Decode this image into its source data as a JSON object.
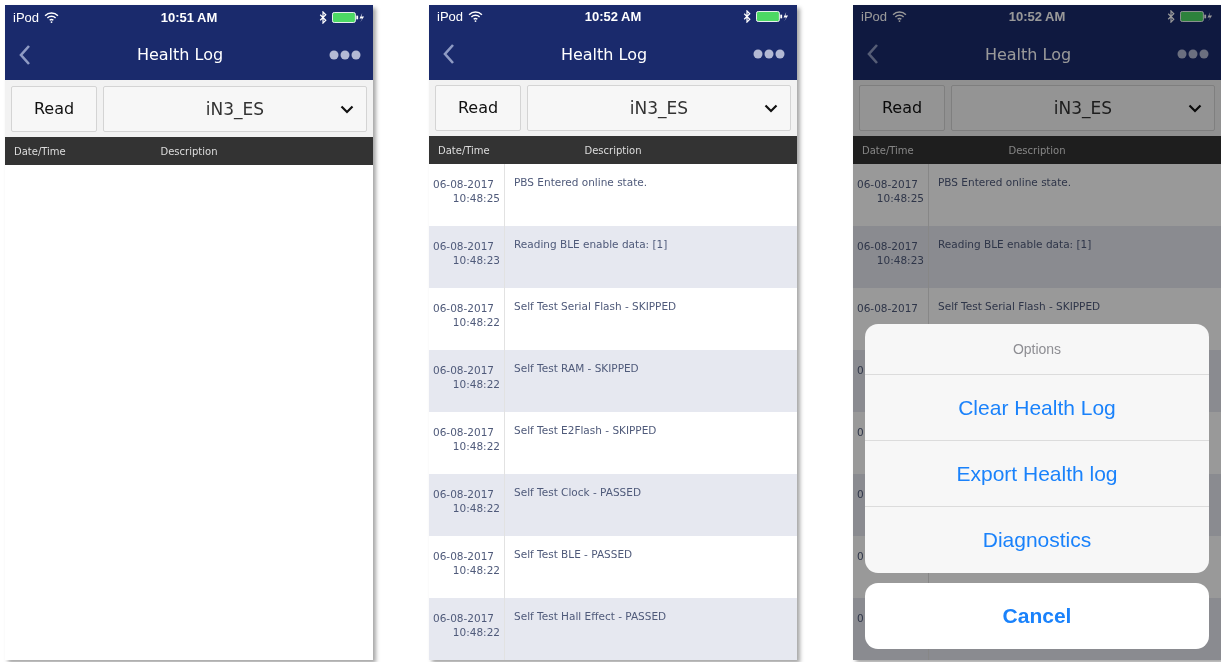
{
  "screens": [
    {
      "status_bar": {
        "carrier": "iPod",
        "time": "10:51 AM"
      },
      "title": "Health Log",
      "read_button": "Read",
      "device": "iN3_ES",
      "columns": [
        "Date/Time",
        "Description"
      ]
    },
    {
      "status_bar": {
        "carrier": "iPod",
        "time": "10:52 AM"
      },
      "title": "Health Log",
      "read_button": "Read",
      "device": "iN3_ES",
      "columns": [
        "Date/Time",
        "Description"
      ],
      "rows": [
        {
          "date": "06-08-2017",
          "time": "10:48:25",
          "description": "PBS Entered online state."
        },
        {
          "date": "06-08-2017",
          "time": "10:48:23",
          "description": "Reading BLE enable data: [1]"
        },
        {
          "date": "06-08-2017",
          "time": "10:48:22",
          "description": "Self Test Serial Flash - SKIPPED"
        },
        {
          "date": "06-08-2017",
          "time": "10:48:22",
          "description": "Self Test RAM - SKIPPED"
        },
        {
          "date": "06-08-2017",
          "time": "10:48:22",
          "description": "Self Test E2Flash - SKIPPED"
        },
        {
          "date": "06-08-2017",
          "time": "10:48:22",
          "description": "Self Test Clock - PASSED"
        },
        {
          "date": "06-08-2017",
          "time": "10:48:22",
          "description": "Self Test BLE - PASSED"
        },
        {
          "date": "06-08-2017",
          "time": "10:48:22",
          "description": "Self Test Hall Effect - PASSED"
        }
      ]
    },
    {
      "status_bar": {
        "carrier": "iPod",
        "time": "10:52 AM"
      },
      "title": "Health Log",
      "read_button": "Read",
      "device": "iN3_ES",
      "columns": [
        "Date/Time",
        "Description"
      ],
      "rows": [
        {
          "date": "06-08-2017",
          "time": "10:48:25",
          "description": "PBS Entered online state."
        },
        {
          "date": "06-08-2017",
          "time": "10:48:23",
          "description": "Reading BLE enable data: [1]"
        },
        {
          "date": "06-08-2017",
          "description": "Self Test Serial Flash - SKIPPED"
        },
        {
          "date": "0"
        },
        {
          "date": "0"
        },
        {
          "date": "0"
        },
        {
          "date": "0"
        },
        {
          "date": "0"
        }
      ],
      "action_sheet": {
        "title": "Options",
        "actions": [
          "Clear Health Log",
          "Export Health log",
          "Diagnostics"
        ],
        "cancel": "Cancel"
      }
    }
  ]
}
